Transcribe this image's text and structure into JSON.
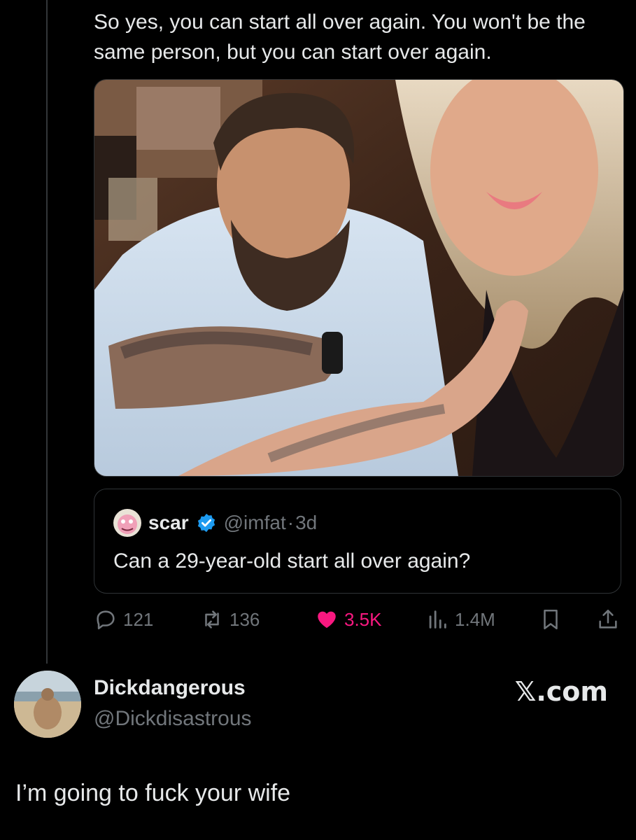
{
  "tweet": {
    "text": "So yes, you can start all over again.  You won't be the same person, but you can start over again."
  },
  "media": {
    "description_icon": "photo"
  },
  "quote": {
    "display_name": "scar",
    "verified": true,
    "handle": "@imfat",
    "separator": "·",
    "time": "3d",
    "text": "Can a 29-year-old start all over again?"
  },
  "actions": {
    "replies": "121",
    "reposts": "136",
    "likes": "3.5K",
    "views": "1.4M"
  },
  "reply": {
    "display_name": "Dickdangerous",
    "handle": "@Dickdisastrous",
    "brand": "𝕏.com",
    "text": "I’m going to fuck your wife"
  },
  "colors": {
    "background": "#000000",
    "text": "#e7e9ea",
    "muted": "#71767b",
    "like": "#f91880",
    "verified": "#1d9bf0",
    "border": "#2f3336"
  }
}
